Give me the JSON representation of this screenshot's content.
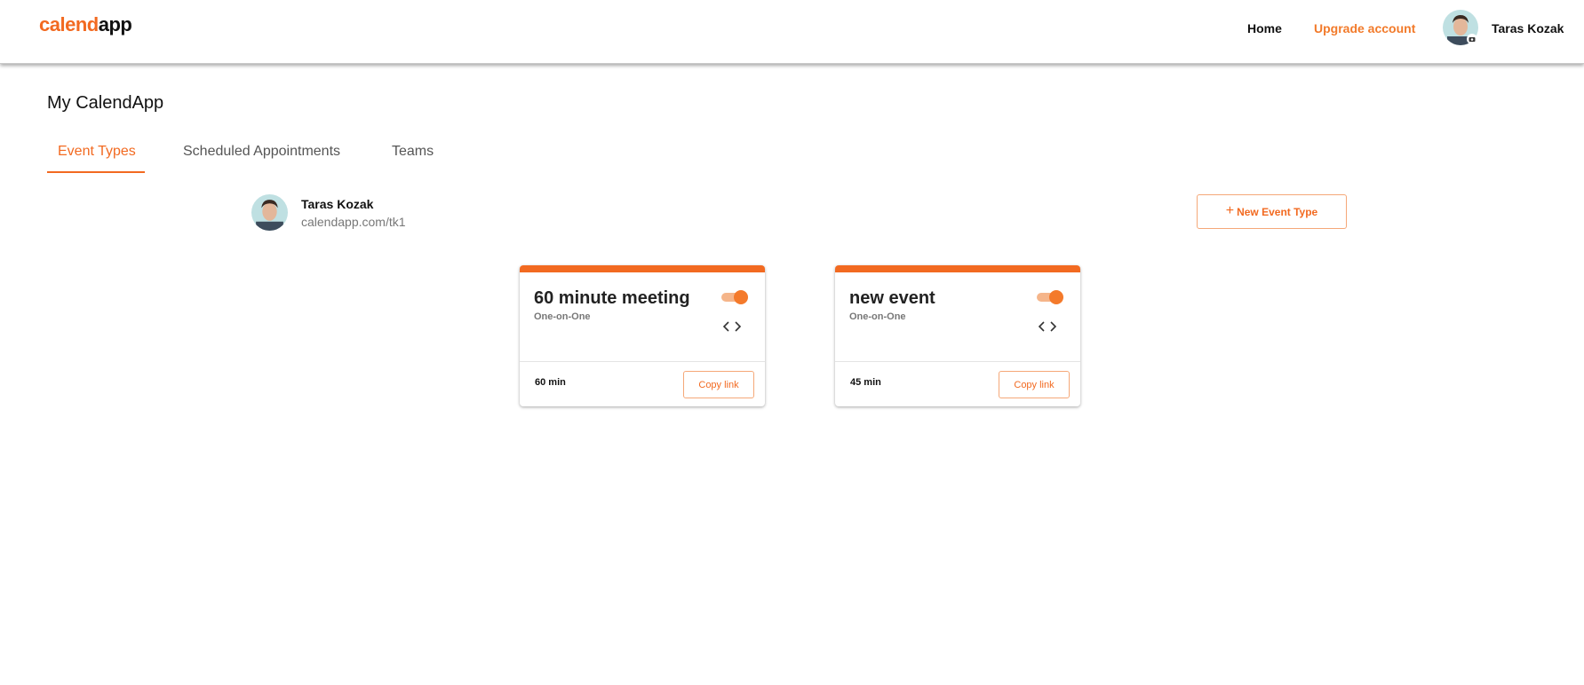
{
  "header": {
    "logo_part1": "calend",
    "logo_part2": "app",
    "nav_home": "Home",
    "nav_upgrade": "Upgrade account",
    "user_name": "Taras Kozak"
  },
  "page": {
    "title": "My CalendApp",
    "tabs": [
      {
        "label": "Event Types",
        "active": true
      },
      {
        "label": "Scheduled Appointments",
        "active": false
      },
      {
        "label": "Teams",
        "active": false
      }
    ]
  },
  "profile": {
    "name": "Taras Kozak",
    "url": "calendapp.com/tk1",
    "new_event_label": "New Event Type"
  },
  "events": [
    {
      "title": "60 minute meeting",
      "type": "One-on-One",
      "duration": "60 min",
      "enabled": true,
      "copy_label": "Copy link"
    },
    {
      "title": "new event",
      "type": "One-on-One",
      "duration": "45 min",
      "enabled": true,
      "copy_label": "Copy link"
    }
  ],
  "colors": {
    "accent": "#f26a21",
    "toggle_track": "#f5b58a",
    "text_primary": "#111111",
    "text_muted": "#777777"
  },
  "icons": {
    "camera": "camera-icon",
    "plus": "plus-icon",
    "code": "code-embed-icon"
  }
}
